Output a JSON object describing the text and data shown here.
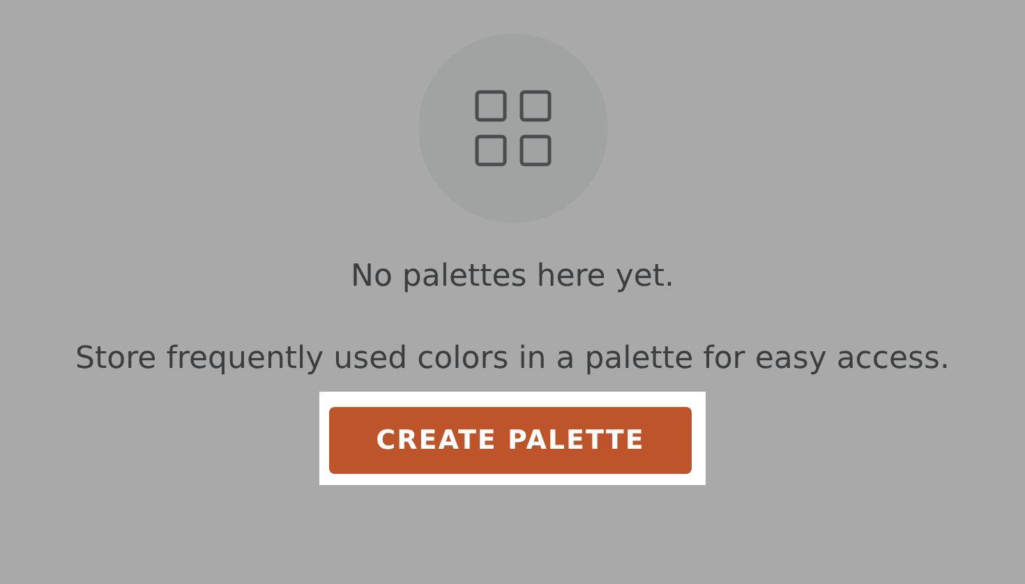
{
  "empty_state": {
    "title": "No palettes here yet.",
    "description": "Store frequently used colors in a palette for easy access.",
    "button": {
      "label": "CREATE PALETTE",
      "highlighted": true
    }
  }
}
